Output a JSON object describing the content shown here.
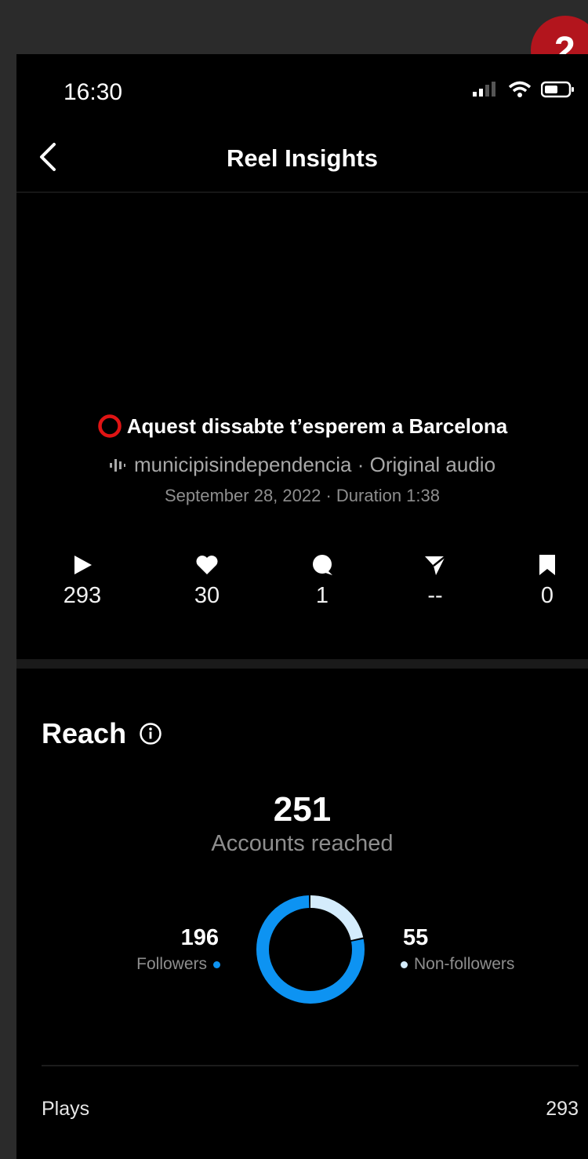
{
  "badge": "2",
  "status_bar": {
    "time": "16:30"
  },
  "header": {
    "title": "Reel Insights"
  },
  "reel": {
    "title": "Aquest dissabte t’esperem a Barcelona",
    "audio": "municipisindependencia · Original audio",
    "meta": "September 28, 2022 · Duration 1:38"
  },
  "stats": [
    {
      "icon": "play-icon",
      "value": "293"
    },
    {
      "icon": "heart-icon",
      "value": "30"
    },
    {
      "icon": "comment-icon",
      "value": "1"
    },
    {
      "icon": "share-icon",
      "value": "--"
    },
    {
      "icon": "bookmark-icon",
      "value": "0"
    }
  ],
  "reach": {
    "title": "Reach",
    "accounts_value": "251",
    "accounts_label": "Accounts reached",
    "followers": {
      "value": "196",
      "label": "Followers",
      "color": "#0d93f2"
    },
    "non_followers": {
      "value": "55",
      "label": "Non-followers",
      "color": "#d4ecfc"
    }
  },
  "plays_row": {
    "label": "Plays",
    "value": "293"
  },
  "colors": {
    "background": "#000000",
    "accent": "#0d93f2",
    "muted": "#8e8e8e"
  }
}
